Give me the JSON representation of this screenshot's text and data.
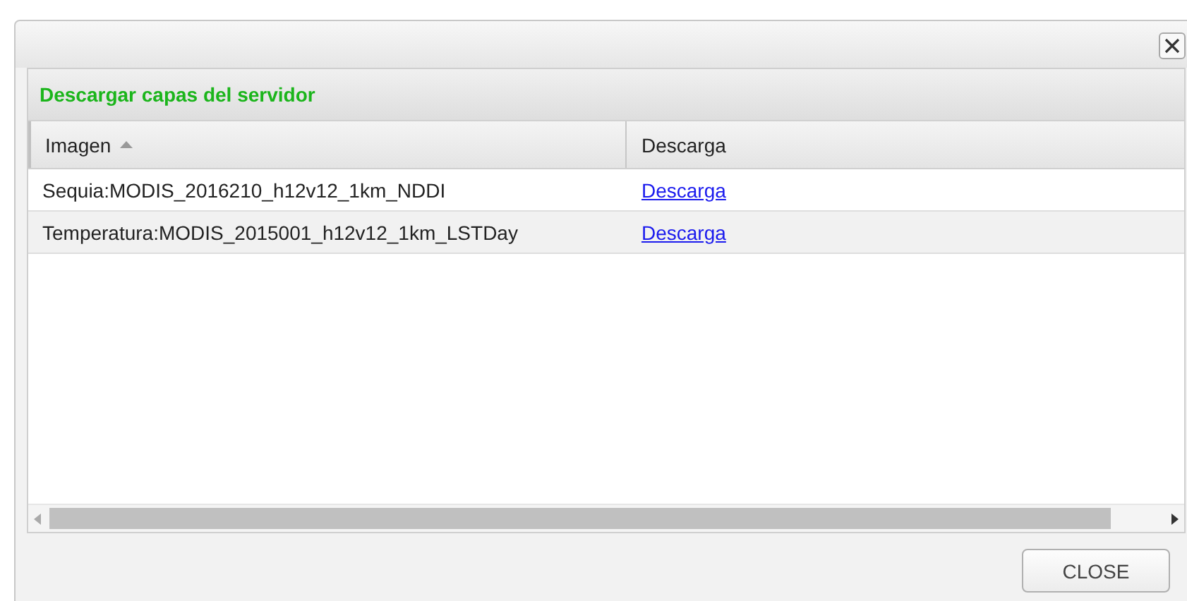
{
  "panel": {
    "title": "Descargar capas del servidor"
  },
  "table": {
    "columns": [
      {
        "label": "Imagen",
        "sorted_ascending": true
      },
      {
        "label": "Descarga",
        "sorted_ascending": false
      }
    ],
    "rows": [
      {
        "image": "Sequia:MODIS_2016210_h12v12_1km_NDDI",
        "link": "Descarga"
      },
      {
        "image": "Temperatura:MODIS_2015001_h12v12_1km_LSTDay",
        "link": "Descarga"
      }
    ]
  },
  "buttons": [
    {
      "label": "CLOSE"
    }
  ]
}
